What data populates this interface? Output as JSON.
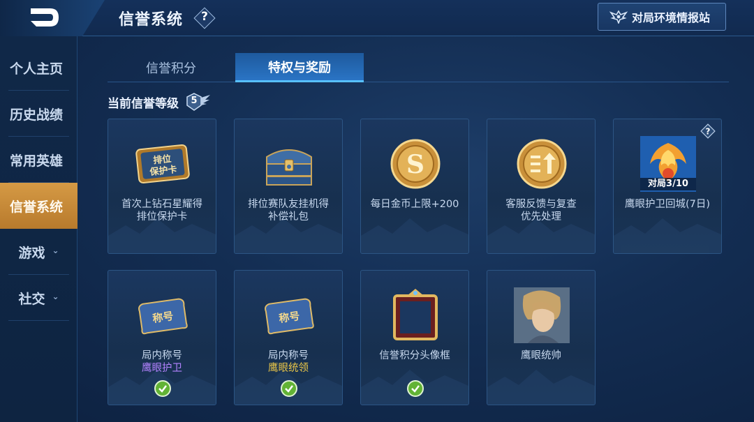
{
  "header": {
    "title": "信誉系统",
    "help_symbol": "?",
    "report_button": "对局环境情报站"
  },
  "sidebar": {
    "items": [
      {
        "label": "个人主页",
        "active": false
      },
      {
        "label": "历史战绩",
        "active": false
      },
      {
        "label": "常用英雄",
        "active": false
      },
      {
        "label": "信誉系统",
        "active": true
      },
      {
        "label": "游戏",
        "expandable": true
      },
      {
        "label": "社交",
        "expandable": true
      }
    ]
  },
  "tabs": [
    {
      "label": "信誉积分",
      "active": false
    },
    {
      "label": "特权与奖励",
      "active": true
    }
  ],
  "level": {
    "label": "当前信誉等级",
    "value": "5"
  },
  "cards": [
    {
      "line1": "首次上钻石星耀得",
      "line2": "排位保护卡",
      "art": "ranked-protection-card",
      "art_text": [
        "排位",
        "保护卡"
      ]
    },
    {
      "line1": "排位赛队友挂机得",
      "line2": "补偿礼包",
      "art": "treasure-chest"
    },
    {
      "line1": "每日金币上限+200",
      "art": "gold-coin",
      "art_text": "S"
    },
    {
      "line1": "客服反馈与复查",
      "line2": "优先处理",
      "art": "priority-coin",
      "art_text": "三↑"
    },
    {
      "line1": "鹰眼护卫回城(7日)",
      "art": "phoenix-recall",
      "progress": "对局3/10",
      "help": "?"
    },
    {
      "line1": "局内称号",
      "line2": "鹰眼护卫",
      "line2_color": "#b383ff",
      "art": "title-scroll",
      "art_text": "称号",
      "owned": true
    },
    {
      "line1": "局内称号",
      "line2": "鹰眼统领",
      "line2_color": "#e8c548",
      "art": "title-scroll",
      "art_text": "称号",
      "owned": true
    },
    {
      "line1": "信誉积分头像框",
      "art": "avatar-frame",
      "owned": true
    },
    {
      "line1": "鹰眼统帅",
      "art": "hero-portrait"
    }
  ],
  "colors": {
    "active_tab": "#2a74c4",
    "active_sidebar": "#d59a45",
    "check_green": "#62b335",
    "purple_title": "#b383ff",
    "gold_title": "#e8c548"
  }
}
